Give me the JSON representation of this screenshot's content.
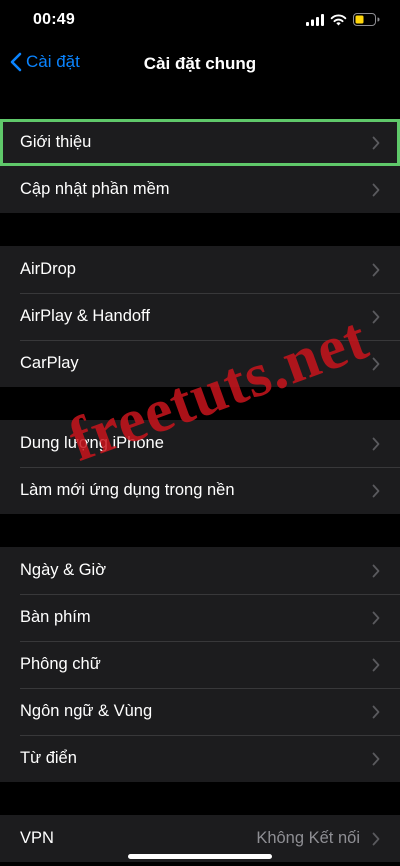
{
  "status_bar": {
    "time": "00:49",
    "icons": [
      "signal-icon",
      "wifi-icon",
      "battery-icon"
    ],
    "battery_color": "#ffd60a"
  },
  "nav": {
    "back_label": "Cài đặt",
    "title": "Cài đặt chung"
  },
  "groups": [
    {
      "items": [
        {
          "label": "Giới thiệu",
          "highlighted": true
        },
        {
          "label": "Cập nhật phần mềm"
        }
      ]
    },
    {
      "items": [
        {
          "label": "AirDrop"
        },
        {
          "label": "AirPlay & Handoff"
        },
        {
          "label": "CarPlay"
        }
      ]
    },
    {
      "items": [
        {
          "label": "Dung lượng iPhone"
        },
        {
          "label": "Làm mới ứng dụng trong nền"
        }
      ]
    },
    {
      "items": [
        {
          "label": "Ngày & Giờ"
        },
        {
          "label": "Bàn phím"
        },
        {
          "label": "Phông chữ"
        },
        {
          "label": "Ngôn ngữ & Vùng"
        },
        {
          "label": "Từ điển"
        }
      ]
    },
    {
      "items": [
        {
          "label": "VPN",
          "value": "Không Kết nối"
        }
      ]
    }
  ],
  "watermark": "freetuts.net",
  "colors": {
    "accent": "#0a84ff",
    "highlight_outline": "#5fc86a",
    "cell_background": "#1c1c1e",
    "watermark": "#c8141c"
  }
}
